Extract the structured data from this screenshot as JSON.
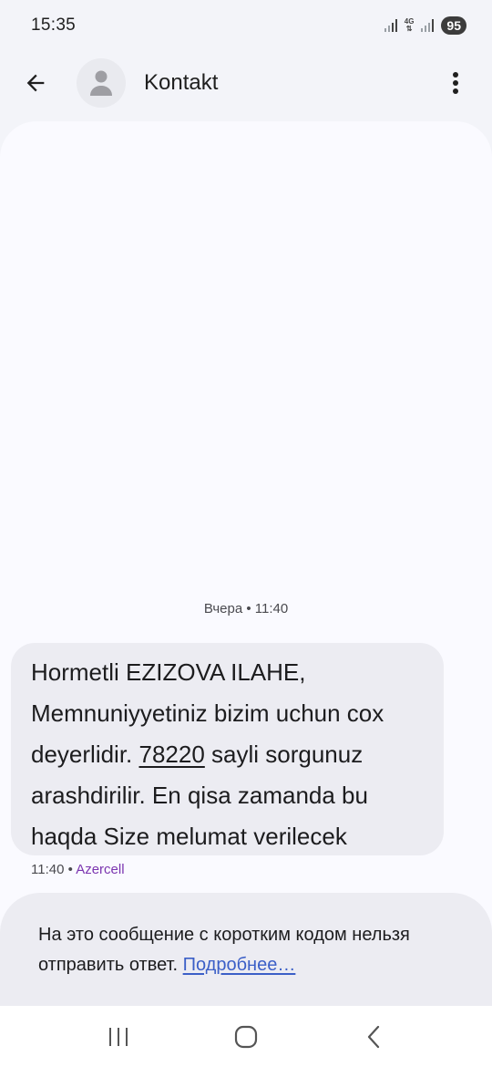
{
  "status_bar": {
    "time": "15:35",
    "network": "4G",
    "battery": "95"
  },
  "app_bar": {
    "contact_name": "Kontakt",
    "icons": [
      "back-arrow-icon",
      "person-icon",
      "more-vert-icon"
    ]
  },
  "conversation": {
    "divider": "Вчера • 11:40",
    "message": {
      "text_before": "Hormetli EZIZOVA ILAHE, Memnuniyyetiniz bizim uchun cox deyerlidir. ",
      "code": "78220",
      "text_after": " sayli sorgunuz arashdirilir. En qisa zamanda bu haqda Size melumat verilecek",
      "time": "11:40",
      "separator": " • ",
      "sender": "Azercell"
    },
    "notice": {
      "text": "На это сообщение с коротким кодом нельзя отправить ответ. ",
      "link": "Подробнее…"
    }
  },
  "nav_bar": {
    "icons": [
      "recent-apps-icon",
      "home-icon",
      "back-icon"
    ]
  },
  "colors": {
    "background": "#f3f4f9",
    "panel": "#fafaff",
    "bubble": "#ececf2",
    "sender": "#7b35b0",
    "link": "#3b5fc7"
  }
}
